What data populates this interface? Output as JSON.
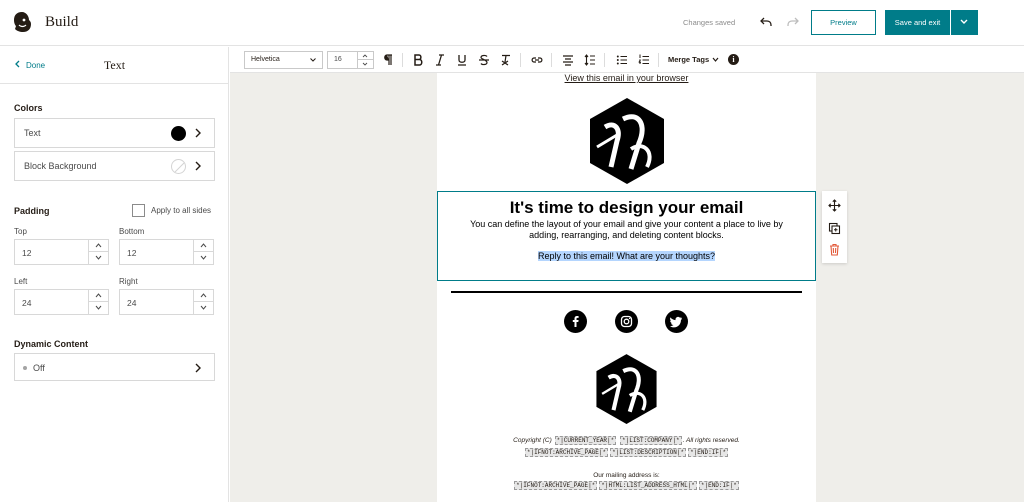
{
  "header": {
    "title": "Build",
    "status": "Changes saved",
    "preview_label": "Preview",
    "save_label": "Save and exit"
  },
  "sidebar": {
    "back_label": "Done",
    "title": "Text",
    "colors_heading": "Colors",
    "color_rows": [
      {
        "label": "Text",
        "value": "#000000"
      },
      {
        "label": "Block Background",
        "value": "none"
      }
    ],
    "padding_heading": "Padding",
    "apply_all_label": "Apply to all sides",
    "apply_all_checked": false,
    "padding": {
      "top_label": "Top",
      "top_value": "12",
      "bottom_label": "Bottom",
      "bottom_value": "12",
      "left_label": "Left",
      "left_value": "24",
      "right_label": "Right",
      "right_value": "24"
    },
    "dynamic_heading": "Dynamic Content",
    "dynamic_value": "Off"
  },
  "toolbar": {
    "font_family": "Helvetica",
    "font_size": "16",
    "merge_tags_label": "Merge Tags",
    "icons": [
      "paragraph-icon",
      "bold-icon",
      "italic-icon",
      "underline-icon",
      "strikethrough-icon",
      "clear-format-icon",
      "link-icon",
      "align-icon",
      "line-height-icon",
      "bullet-list-icon",
      "numbered-list-icon",
      "info-icon"
    ]
  },
  "email": {
    "view_in_browser": "View this email in your browser",
    "hero_title": "It's time to design your email",
    "hero_body": "You can define the layout of your email and give your content a place to live by adding, rearranging, and deleting content blocks.",
    "hero_reply": "Reply to this email! What are your thoughts?",
    "social": [
      "facebook-icon",
      "instagram-icon",
      "twitter-icon"
    ],
    "footer": {
      "copyright_prefix": "Copyright (C)",
      "tag_current_year": "*|CURRENT_YEAR|*",
      "tag_list_company": "*|LIST:COMPANY|*",
      "rights": ". All rights reserved.",
      "tag_ifnot_archive": "*|IFNOT:ARCHIVE_PAGE|*",
      "tag_list_description": "*|LIST:DESCRIPTION|*",
      "tag_end_if": "*|END:IF|*",
      "mailing_label": "Our mailing address is:",
      "tag_ifnot_archive_2": "*|IFNOT:ARCHIVE_PAGE|*",
      "tag_list_address": "*|HTML:LIST_ADDRESS_HTML|*",
      "tag_end_if_2": "*|END:IF|*"
    }
  },
  "colors": {
    "accent": "#007c89",
    "selection": "#b4d5fe",
    "canvas_bg": "#efeeea",
    "delete": "#e35a3a"
  }
}
